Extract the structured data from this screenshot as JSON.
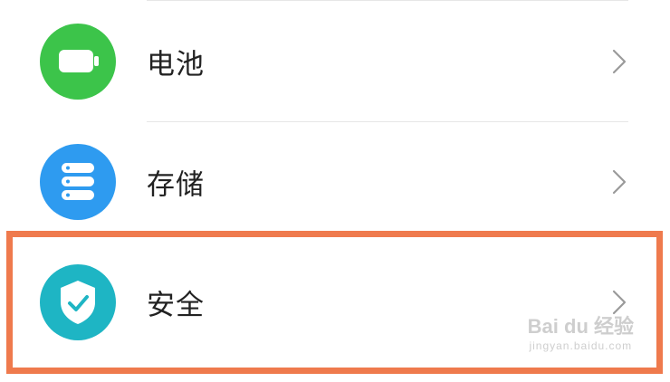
{
  "settings": {
    "items": [
      {
        "label": "电池",
        "icon": "battery-icon",
        "icon_color": "#3cc44a"
      },
      {
        "label": "存储",
        "icon": "storage-icon",
        "icon_color": "#2e9bf0"
      },
      {
        "label": "安全",
        "icon": "shield-icon",
        "icon_color": "#1eb5c4"
      }
    ]
  },
  "highlight_color": "#ef7a4d",
  "watermark": {
    "main": "Bai du 经验",
    "sub": "jingyan.baidu.com"
  }
}
